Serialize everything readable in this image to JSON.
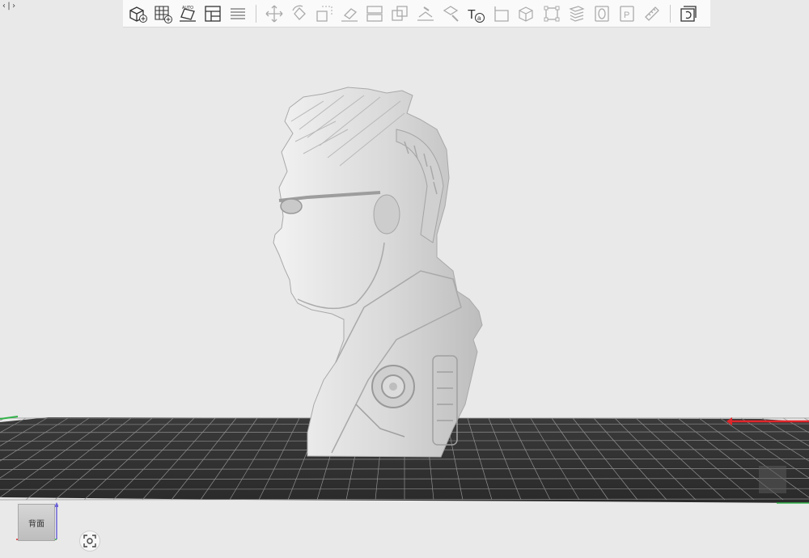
{
  "window": {
    "collapse_toggle": "‹|›"
  },
  "toolbar": {
    "groups": [
      [
        "add-model-icon",
        "add-grid-icon",
        "auto-arrange-icon",
        "layout-panel-icon",
        "layers-list-icon"
      ],
      [
        "move-icon",
        "rotate-icon",
        "scale-icon",
        "lay-flat-icon",
        "cut-icon",
        "duplicate-icon",
        "support-paint-icon",
        "seam-paint-icon",
        "text-tool-icon",
        "corner-icon",
        "cube-icon",
        "bounding-box-icon",
        "slice-stack-icon",
        "hollow-icon",
        "plate-icon",
        "measure-icon"
      ],
      [
        "export-icon"
      ]
    ],
    "text_tool_glyph": "Ta"
  },
  "view_cube": {
    "label": "背面"
  },
  "colors": {
    "background": "#e9e9e9",
    "plate": "#2e2e2e",
    "grid": "#9a9a9a",
    "axis_x": "#e0262b",
    "axis_y": "#33b24a",
    "axis_z": "#6b63d6",
    "model": "#d7d7d7"
  }
}
